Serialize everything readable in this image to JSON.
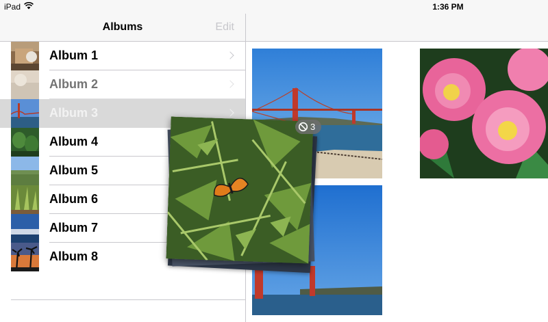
{
  "status_bar": {
    "device": "iPad",
    "time": "1:36 PM"
  },
  "master": {
    "nav": {
      "title": "Albums",
      "edit_label": "Edit"
    },
    "albums": [
      {
        "label": "Album 1",
        "state": "normal"
      },
      {
        "label": "Album 2",
        "state": "dimmed"
      },
      {
        "label": "Album 3",
        "state": "selected"
      },
      {
        "label": "Album 4",
        "state": "normal"
      },
      {
        "label": "Album 5",
        "state": "normal"
      },
      {
        "label": "Album 6",
        "state": "normal"
      },
      {
        "label": "Album 7",
        "state": "normal"
      },
      {
        "label": "Album 8",
        "state": "normal"
      }
    ]
  },
  "drag": {
    "badge_icon": "not-allowed-icon",
    "count": "3"
  },
  "colors": {
    "nav_background": "#f7f7f7",
    "separator": "#c8c7cc",
    "selected_row": "#d9d9d9",
    "disabled_text": "#c7c7cc"
  }
}
